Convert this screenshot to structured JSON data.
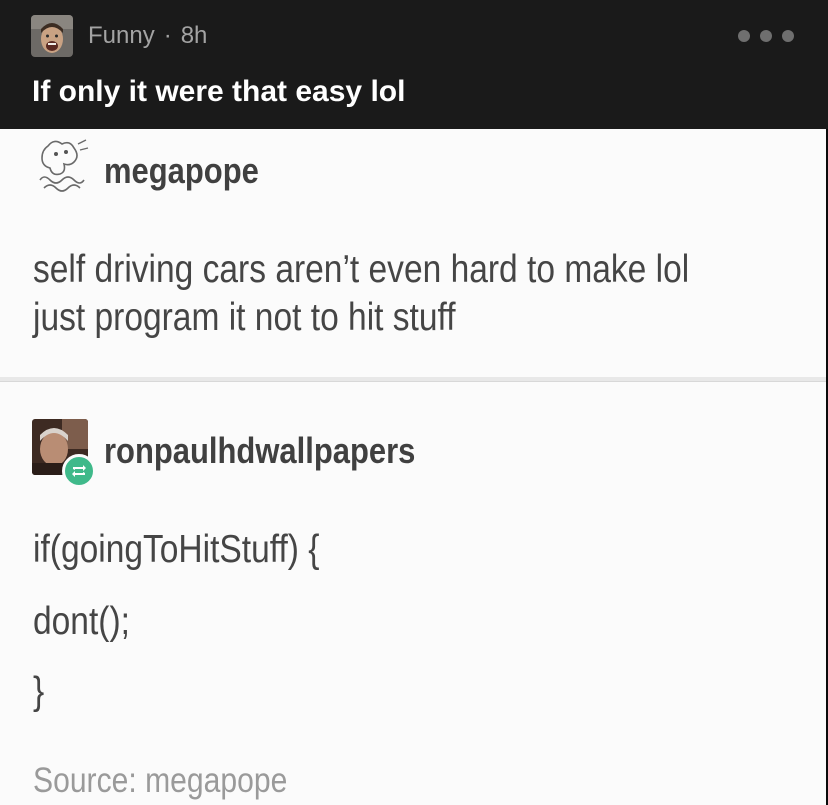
{
  "header": {
    "group_name": "Funny",
    "separator": "·",
    "age": "8h",
    "title": "If only it were that easy lol",
    "more_icon": "ellipsis-icon"
  },
  "post": {
    "first_user": {
      "username": "megapope",
      "lines": [
        "self driving cars aren’t even hard to make lol",
        "just program it not to hit stuff"
      ]
    },
    "second_user": {
      "username": "ronpaulhdwallpapers",
      "badge_icon": "reblog-icon",
      "badge_color": "#3fb98a",
      "code_lines": [
        "if(goingToHitStuff) {",
        "dont();",
        "}"
      ]
    },
    "source": "Source: megapope"
  }
}
